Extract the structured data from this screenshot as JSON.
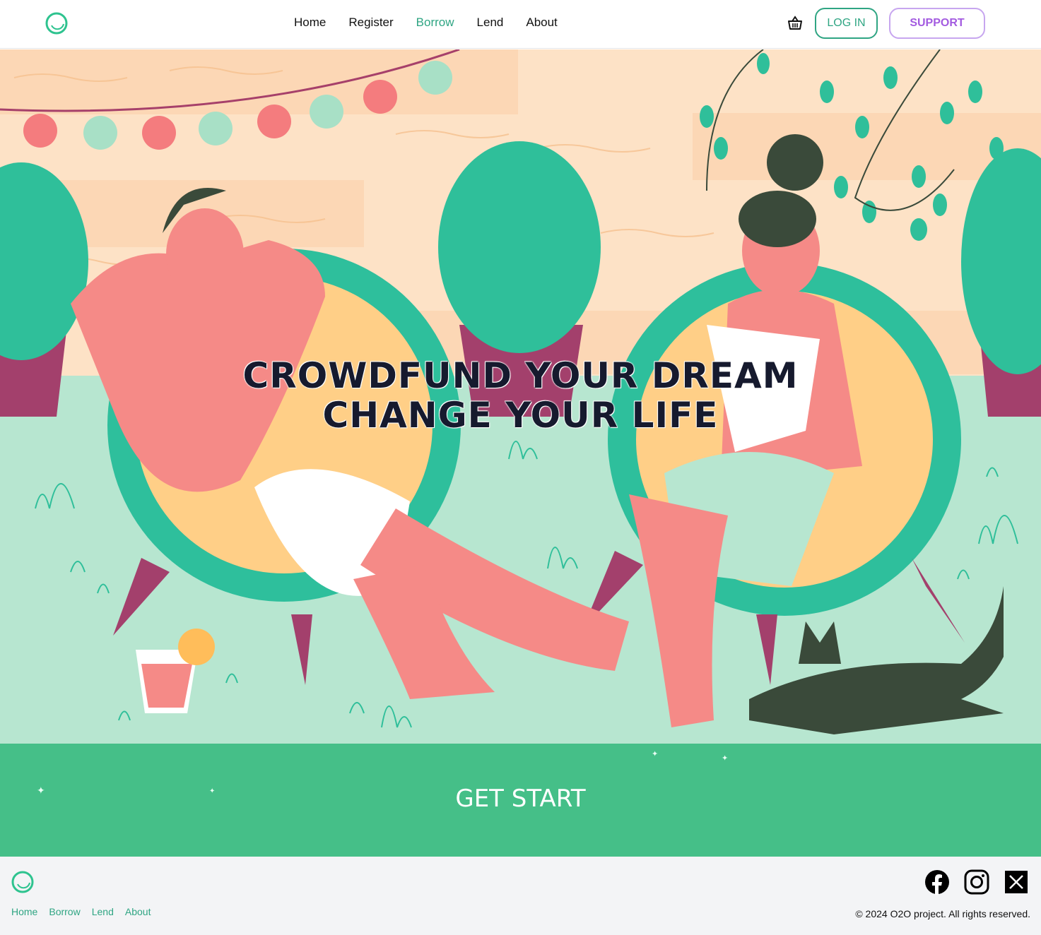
{
  "header": {
    "logo": "ring-logo-icon",
    "nav": [
      {
        "label": "Home",
        "active": false
      },
      {
        "label": "Register",
        "active": false
      },
      {
        "label": "Borrow",
        "active": true
      },
      {
        "label": "Lend",
        "active": false
      },
      {
        "label": "About",
        "active": false
      }
    ],
    "cart_icon": "basket-icon",
    "login_label": "LOG IN",
    "support_label": "SUPPORT"
  },
  "hero": {
    "line1": "CROWDFUND YOUR DREAM",
    "line2": "CHANGE YOUR LIFE"
  },
  "cta": {
    "label": "GET START"
  },
  "footer": {
    "links": [
      "Home",
      "Borrow",
      "Lend",
      "About"
    ],
    "social": [
      "facebook-icon",
      "instagram-icon",
      "x-icon"
    ],
    "copyright": "© 2024 O2O project. All rights reserved."
  },
  "colors": {
    "accent": "#2fa583",
    "support": "#a35be0",
    "cta_bg": "#45bf88",
    "footer_bg": "#f3f4f6"
  }
}
